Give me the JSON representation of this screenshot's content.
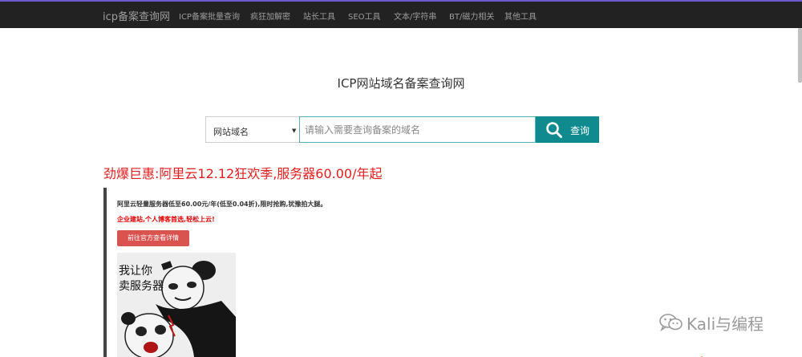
{
  "nav": {
    "brand": "icp备案查询网",
    "items": [
      {
        "label": "ICP备案批量查询"
      },
      {
        "label": "疯狂加解密"
      },
      {
        "label": "站长工具"
      },
      {
        "label": "SEO工具"
      },
      {
        "label": "文本/字符串"
      },
      {
        "label": "BT/磁力相关"
      },
      {
        "label": "其他工具"
      }
    ]
  },
  "main": {
    "title": "ICP网站域名备案查询网",
    "search": {
      "select_value": "网站域名",
      "placeholder": "请输入需要查询备案的域名",
      "value": "",
      "button_label": "查询"
    }
  },
  "promo": {
    "heading": "劲爆巨惠:阿里云12.12狂欢季,服务器60.00/年起",
    "line1": "阿里云轻量服务器低至60.00元/年(低至0.04折),限时抢购,犹豫拍大腿。",
    "line2": "企业建站,个人博客首选,轻松上云!",
    "button_label": "前往官方查看详情",
    "meme_text": "我让你\n卖服务器"
  },
  "watermark": {
    "text": "Kali与编程"
  },
  "colors": {
    "navbar_bg": "#222222",
    "accent_teal": "#0f8a8e",
    "promo_red": "#e02020",
    "button_red": "#d9534f"
  }
}
